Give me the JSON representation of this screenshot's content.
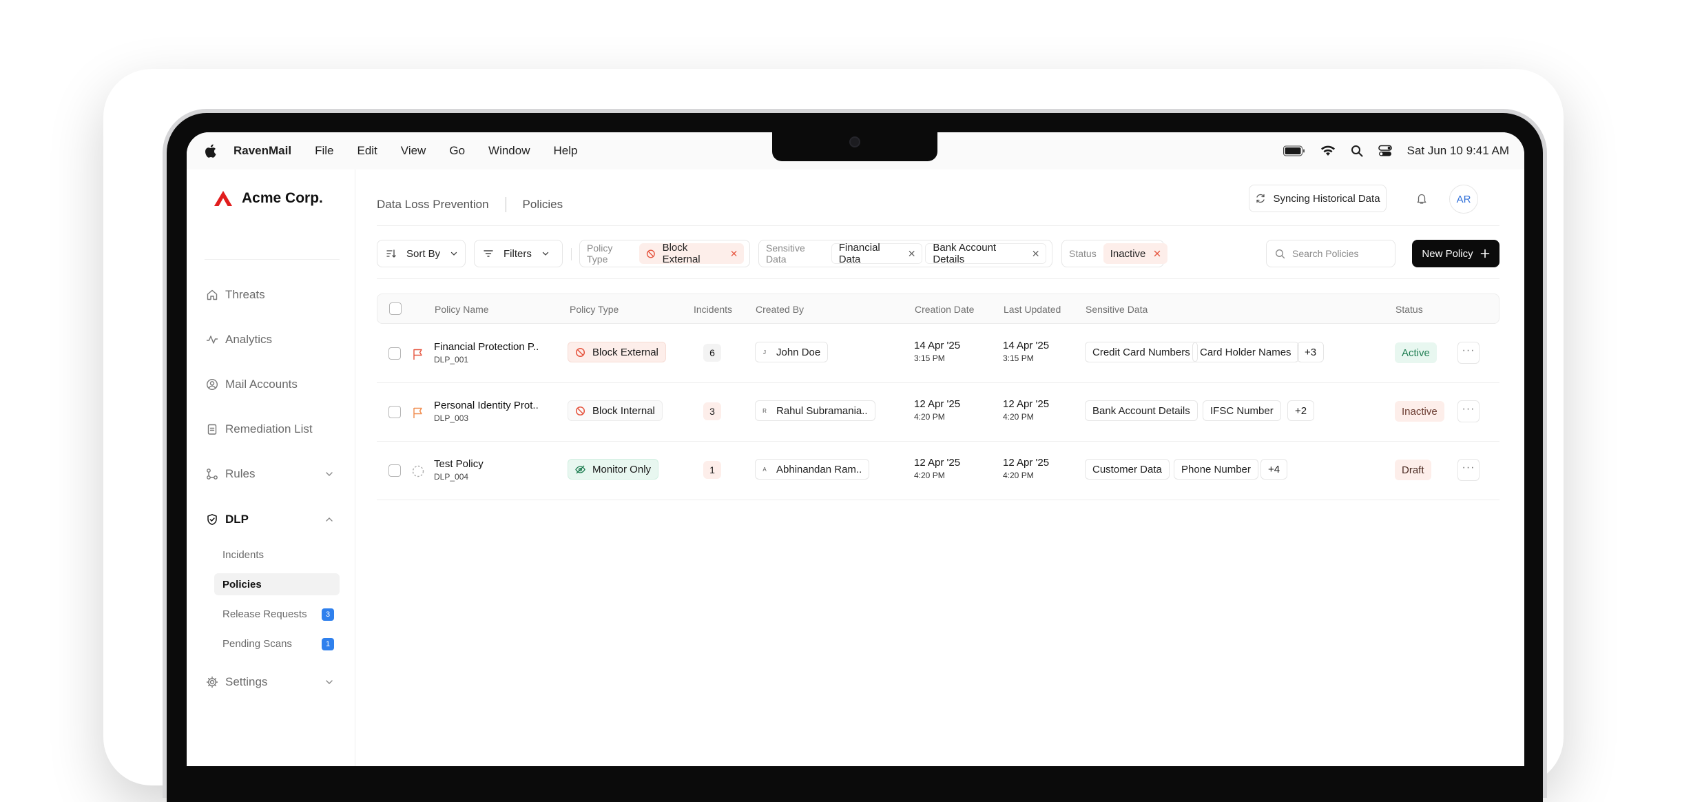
{
  "menubar": {
    "app_name": "RavenMail",
    "menus": [
      "File",
      "Edit",
      "View",
      "Go",
      "Window",
      "Help"
    ],
    "clock": "Sat Jun 10  9:41 AM"
  },
  "brand": {
    "name": "Acme Corp.",
    "color": "#e11d1d"
  },
  "sidebar": {
    "items": [
      {
        "label": "Threats",
        "icon": "home-icon"
      },
      {
        "label": "Analytics",
        "icon": "activity-icon"
      },
      {
        "label": "Mail Accounts",
        "icon": "user-circle-icon"
      },
      {
        "label": "Remediation List",
        "icon": "clipboard-icon"
      },
      {
        "label": "Rules",
        "icon": "rules-icon"
      },
      {
        "label": "DLP",
        "icon": "shield-icon"
      },
      {
        "label": "Settings",
        "icon": "gear-icon"
      }
    ],
    "dlp_sub": [
      {
        "label": "Incidents"
      },
      {
        "label": "Policies"
      },
      {
        "label": "Release Requests",
        "count": "3"
      },
      {
        "label": "Pending Scans",
        "count": "1"
      }
    ]
  },
  "header": {
    "breadcrumb": [
      "Data Loss Prevention",
      "Policies"
    ],
    "sync_label": "Syncing Historical Data",
    "avatar_initials": "AR"
  },
  "toolbar": {
    "sort_label": "Sort By",
    "filters_label": "Filters",
    "filter_policy_type": {
      "label": "Policy Type",
      "chips": [
        "Block External"
      ]
    },
    "filter_sensitive": {
      "label": "Sensitive Data",
      "chips": [
        "Financial Data",
        "Bank Account Details"
      ]
    },
    "filter_status": {
      "label": "Status",
      "chips": [
        "Inactive"
      ]
    },
    "search_placeholder": "Search Policies",
    "new_policy_label": "New Policy"
  },
  "table": {
    "columns": [
      "Policy Name",
      "Policy Type",
      "Incidents",
      "Created By",
      "Creation Date",
      "Last Updated",
      "Sensitive Data",
      "Status"
    ],
    "rows": [
      {
        "name": "Financial Protection P..",
        "id": "DLP_001",
        "type": "Block External",
        "incidents": "6",
        "creator_initial": "J",
        "creator": "John Doe",
        "created_date": "14 Apr '25",
        "created_time": "3:15 PM",
        "updated_date": "14 Apr '25",
        "updated_time": "3:15 PM",
        "sensitive": [
          "Credit Card Numbers",
          "Card Holder Names"
        ],
        "more": "+3",
        "status": "Active"
      },
      {
        "name": "Personal Identity Prot..",
        "id": "DLP_003",
        "type": "Block Internal",
        "incidents": "3",
        "creator_initial": "R",
        "creator": "Rahul Subramania..",
        "created_date": "12 Apr '25",
        "created_time": "4:20 PM",
        "updated_date": "12 Apr '25",
        "updated_time": "4:20 PM",
        "sensitive": [
          "Bank Account Details",
          "IFSC Number"
        ],
        "more": "+2",
        "status": "Inactive"
      },
      {
        "name": "Test Policy",
        "id": "DLP_004",
        "type": "Monitor Only",
        "incidents": "1",
        "creator_initial": "A",
        "creator": "Abhinandan Ram..",
        "created_date": "12 Apr '25",
        "created_time": "4:20 PM",
        "updated_date": "12 Apr '25",
        "updated_time": "4:20 PM",
        "sensitive": [
          "Customer Data",
          "Phone Number"
        ],
        "more": "+4",
        "status": "Draft"
      }
    ]
  },
  "colors": {
    "accent_blue": "#2f80ed",
    "danger": "#e5533d",
    "success": "#1e7d51",
    "primary_button": "#0b0b0b"
  }
}
